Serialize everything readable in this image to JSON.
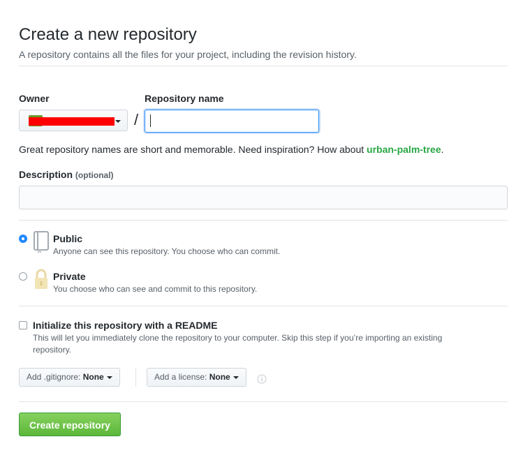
{
  "header": {
    "title": "Create a new repository",
    "subtitle": "A repository contains all the files for your project, including the revision history."
  },
  "form": {
    "owner_label": "Owner",
    "repo_name_label": "Repository name",
    "separator": "/",
    "repo_name_value": "",
    "hint_prefix": "Great repository names are short and memorable. Need inspiration? How about ",
    "hint_suggestion": "urban-palm-tree",
    "hint_suffix": ".",
    "description_label": "Description",
    "description_optional": "(optional)",
    "description_value": ""
  },
  "visibility": {
    "options": [
      {
        "title": "Public",
        "description": "Anyone can see this repository. You choose who can commit.",
        "checked": true,
        "icon": "repo-book-icon"
      },
      {
        "title": "Private",
        "description": "You choose who can see and commit to this repository.",
        "checked": false,
        "icon": "lock-icon"
      }
    ]
  },
  "readme": {
    "title": "Initialize this repository with a README",
    "description": "This will let you immediately clone the repository to your computer. Skip this step if you’re importing an existing repository.",
    "checked": false
  },
  "dropdowns": {
    "gitignore_label": "Add .gitignore:",
    "gitignore_value": "None",
    "license_label": "Add a license:",
    "license_value": "None"
  },
  "submit": {
    "label": "Create repository"
  },
  "colors": {
    "accent_blue": "#2188ff",
    "success_green": "#28a745",
    "button_green": "#5cb739",
    "redaction_red": "#ff0000"
  }
}
